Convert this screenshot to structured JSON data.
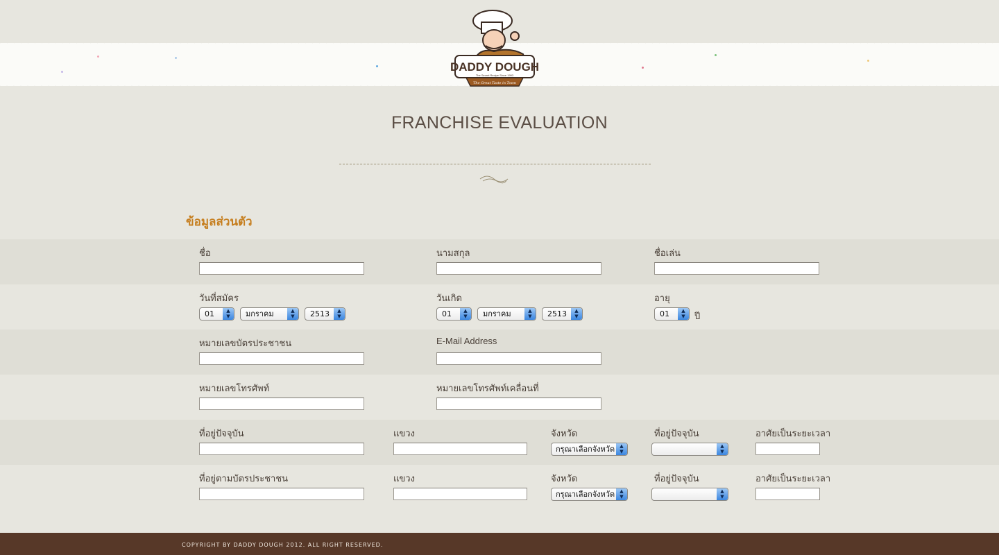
{
  "brand": {
    "logo_name": "DADDY DOUGH",
    "logo_tagline": "The Secret Recipe Since 1993",
    "logo_ribbon": "The Great Taste in Town"
  },
  "page_title": "FRANCHISE EVALUATION",
  "section_title": "ข้อมูลส่วนตัว",
  "form": {
    "first_name_label": "ชื่อ",
    "last_name_label": "นามสกุล",
    "nickname_label": "ชื่อเล่น",
    "apply_date_label": "วันที่สมัคร",
    "birth_date_label": "วันเกิด",
    "age_label": "อายุ",
    "apply_day": "01",
    "apply_month": "มกราคม",
    "apply_year": "2513",
    "birth_day": "01",
    "birth_month": "มกราคม",
    "birth_year": "2513",
    "age_value": "01",
    "age_unit": "ปี",
    "id_card_label": "หมายเลขบัตรประชาชน",
    "email_label": "E-Mail Address",
    "phone_label": "หมายเลขโทรศัพท์",
    "mobile_label": "หมายเลขโทรศัพท์เคลื่อนที่",
    "current_address_label": "ที่อยู่ปัจจุบัน",
    "district_label": "แขวง",
    "province_label": "จังหวัด",
    "current_address_label_2": "ที่อยู่ปัจจุบัน",
    "residence_duration_label": "อาศัยเป็นระยะเวลา",
    "province_placeholder": "กรุณาเลือกจังหวัด",
    "card_address_label": "ที่อยู่ตามบัตรประชาชน"
  },
  "footer": {
    "copyright": "COPYRIGHT BY DADDY DOUGH 2012. ALL RIGHT RESERVED."
  },
  "colors": {
    "background": "#e7e6df",
    "section_accent": "#c67e1e",
    "footer": "#573828"
  }
}
